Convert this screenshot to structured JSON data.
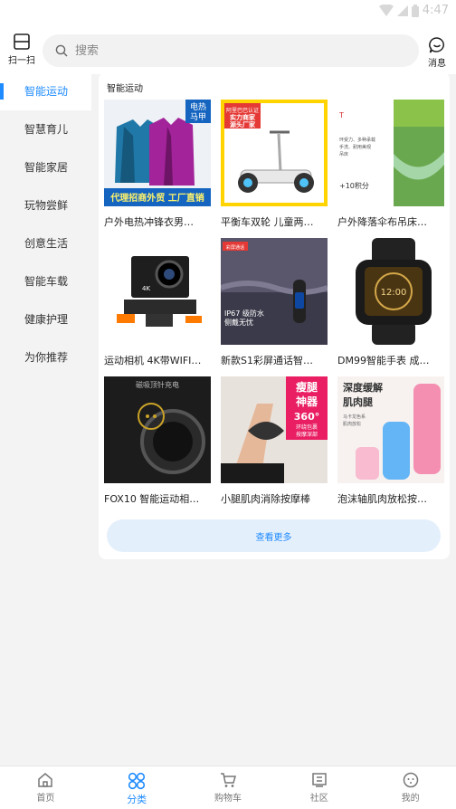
{
  "status": {
    "time": "4:47"
  },
  "header": {
    "scan_label": "扫一扫",
    "search_placeholder": "搜索",
    "messages_label": "消息"
  },
  "sidebar": {
    "items": [
      {
        "label": "智能运动",
        "active": true
      },
      {
        "label": "智慧育儿"
      },
      {
        "label": "智能家居"
      },
      {
        "label": "玩物尝鲜"
      },
      {
        "label": "创意生活"
      },
      {
        "label": "智能车载"
      },
      {
        "label": "健康护理"
      },
      {
        "label": "为你推荐"
      }
    ]
  },
  "main": {
    "title": "智能运动",
    "products": [
      {
        "name": "户外电热冲锋衣男…",
        "image_text": [
          "电热",
          "马甲",
          "代理招商外贸 工厂直销"
        ]
      },
      {
        "name": "平衡车双轮 儿童两…",
        "image_text": [
          "实力商家",
          "源头厂家",
          "阿里巴巴认证"
        ]
      },
      {
        "name": "户外降落伞布吊床…",
        "image_text": [
          "环受力、多种承载",
          "手洗、耐用美观",
          "吊床",
          "+10积分"
        ]
      },
      {
        "name": "运动相机 4K带WIFI…",
        "image_text": [
          "4K"
        ]
      },
      {
        "name": "新款S1彩屏通话智…",
        "image_text": [
          "IP67 级防水",
          "侧戴无忧",
          "彩屏通话"
        ]
      },
      {
        "name": "DM99智能手表 成…",
        "image_text": [
          "12:00"
        ]
      },
      {
        "name": "FOX10 智能运动相…",
        "image_text": [
          "磁吸顶针充电"
        ]
      },
      {
        "name": "小腿肌肉消除按摩棒",
        "image_text": [
          "瘦腿",
          "神器",
          "360°",
          "环绕包裹",
          "按摩深部"
        ]
      },
      {
        "name": "泡沫轴肌肉放松按…",
        "image_text": [
          "深度缓解",
          "肌肉腿",
          "马卡龙色系",
          "肌肉放松"
        ]
      }
    ],
    "more_label": "查看更多"
  },
  "tabs": [
    {
      "label": "首页",
      "icon": "home-icon"
    },
    {
      "label": "分类",
      "icon": "category-icon",
      "active": true
    },
    {
      "label": "购物车",
      "icon": "cart-icon"
    },
    {
      "label": "社区",
      "icon": "community-icon"
    },
    {
      "label": "我的",
      "icon": "profile-icon"
    }
  ],
  "colors": {
    "accent": "#1e8bff",
    "background": "#f3f3f3",
    "surface": "#ffffff",
    "more_button_bg": "#e4effc"
  }
}
